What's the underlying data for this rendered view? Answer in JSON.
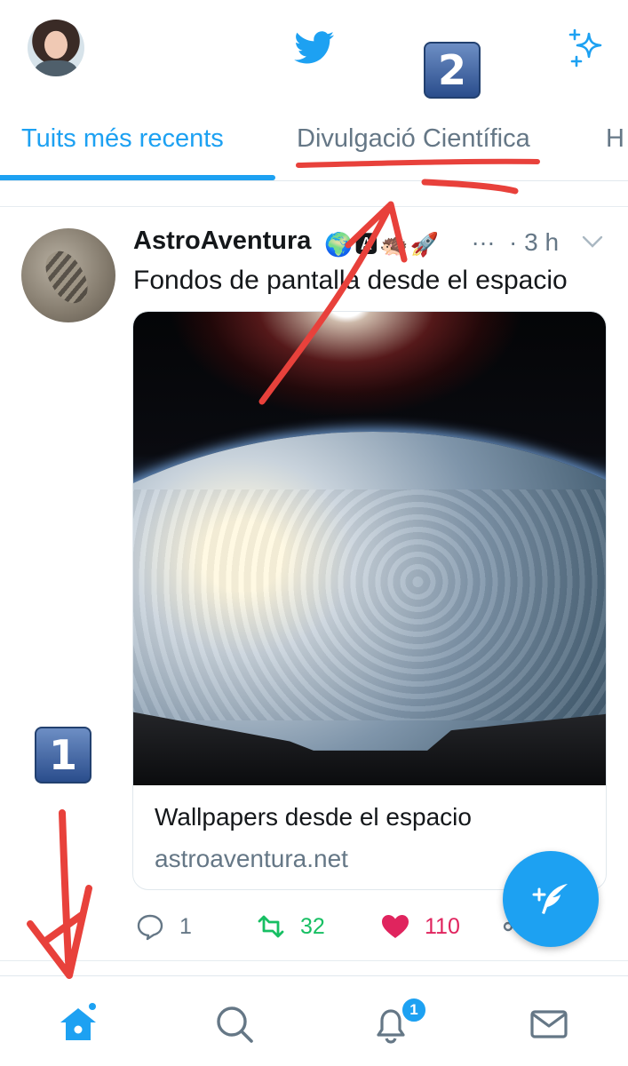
{
  "colors": {
    "accent": "#1da1f2",
    "text_primary": "#14171a",
    "text_secondary": "#657786",
    "retweet": "#17bf63",
    "like": "#e0245e",
    "annotation": "#e8413b"
  },
  "header": {
    "avatar_icon": "profile-avatar",
    "logo_icon": "twitter-bird-icon",
    "sparkle_icon": "sparkle-icon"
  },
  "tabs": [
    {
      "label": "Tuits més recents",
      "active": true
    },
    {
      "label": "Divulgació Científica",
      "active": false
    },
    {
      "label": "H",
      "active": false
    }
  ],
  "annotations": {
    "badge_1": "1",
    "badge_2": "2"
  },
  "tweet": {
    "author": "AstroAventura",
    "emojis": "🌍🅰🦔🚀",
    "ellipsis": "…",
    "time": "· 3 h",
    "text": "Fondos de pantalla desde el espacio",
    "card": {
      "title": "Wallpapers desde el espacio",
      "url": "astroaventura.net"
    },
    "actions": {
      "replies": "1",
      "retweets": "32",
      "likes": "110"
    }
  },
  "bottom_nav": {
    "items": [
      "home-icon",
      "search-icon",
      "bell-icon",
      "mail-icon"
    ],
    "notification_count": "1"
  }
}
